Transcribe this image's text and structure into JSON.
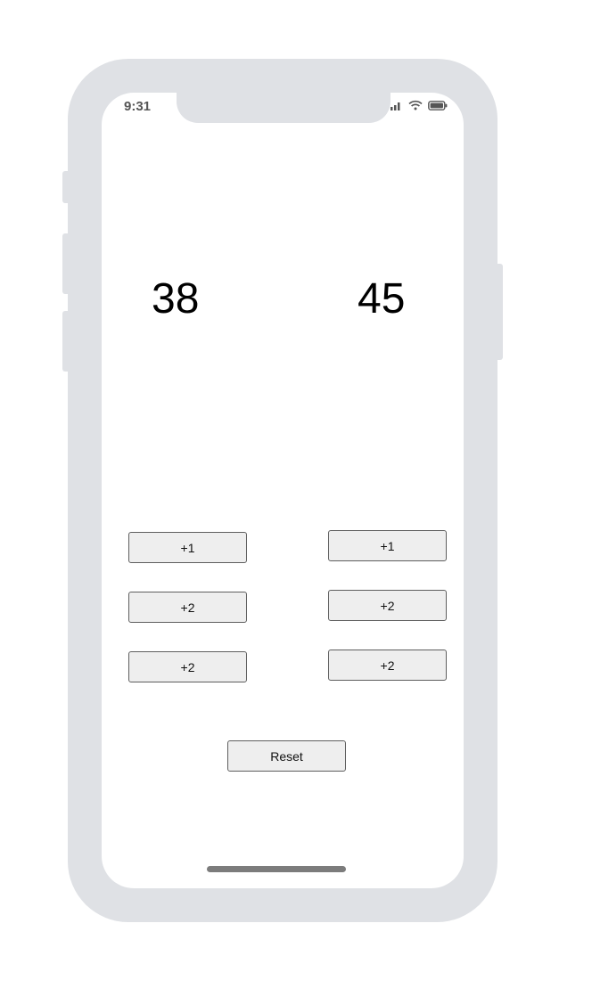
{
  "status_bar": {
    "time": "9:31"
  },
  "scores": {
    "team_a": "38",
    "team_b": "45"
  },
  "team_a_buttons": [
    "+1",
    "+2",
    "+2"
  ],
  "team_b_buttons": [
    "+1",
    "+2",
    "+2"
  ],
  "reset_label": "Reset",
  "colors": {
    "device_frame": "#dfe1e5",
    "button_bg": "#eeeeee",
    "button_border": "#5e5e5e",
    "home_indicator": "#7c7c7c"
  }
}
